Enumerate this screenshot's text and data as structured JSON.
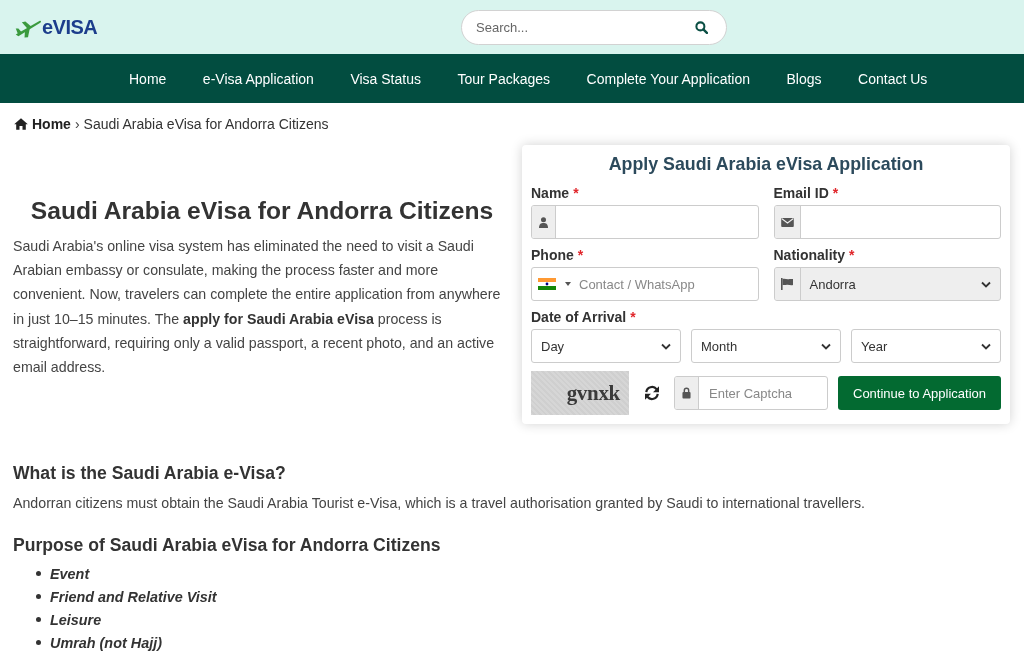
{
  "header": {
    "logo_text": "eVISA",
    "search": {
      "placeholder": "Search..."
    }
  },
  "nav": [
    "Home",
    "e-Visa Application",
    "Visa Status",
    "Tour Packages",
    "Complete Your Application",
    "Blogs",
    "Contact Us"
  ],
  "breadcrumb": {
    "separator": "›",
    "items": [
      {
        "label": "Home",
        "kind": "home"
      },
      {
        "label": "Saudi Arabia eVisa for Andorra Citizens",
        "kind": "current"
      }
    ]
  },
  "intro": {
    "title": "Saudi Arabia eVisa for Andorra Citizens",
    "paragraph": "Saudi Arabia's online visa system has eliminated the need to visit a Saudi Arabian embassy or consulate, making the process faster and more convenient. Now, travelers can complete the entire application from anywhere in just 10–15 minutes. The **apply for Saudi Arabia eVisa** process is straightforward, requiring only a valid passport, a recent photo, and an active email address."
  },
  "form": {
    "title": "Apply Saudi Arabia eVisa Application",
    "fields": [
      {
        "kind": "text",
        "label": "Name",
        "required_mark": "*",
        "disabled": false
      },
      {
        "kind": "email",
        "label": "Email ID",
        "required_mark": "*",
        "disabled": false
      },
      {
        "kind": "phone",
        "label": "Phone",
        "required_mark": "*",
        "placeholder": "Contact / WhatsApp",
        "disabled": false
      },
      {
        "kind": "select",
        "label": "Nationality",
        "required_mark": "*",
        "value": "Andorra",
        "disabled": true
      }
    ],
    "arrival": {
      "label": "Date of Arrival",
      "required_mark": "*",
      "selects": [
        "Day",
        "Month",
        "Year"
      ]
    },
    "captcha": {
      "image_text": "gvnxk",
      "placeholder": "Enter Captcha"
    },
    "submit": "Continue to Application"
  },
  "sections": [
    {
      "heading": "What is the Saudi Arabia e-Visa?",
      "paragraph": "Andorran citizens must obtain the Saudi Arabia Tourist e-Visa, which is a travel authorisation granted by Saudi to international travellers."
    },
    {
      "heading": "Purpose of Saudi Arabia eVisa for Andorra Citizens",
      "items": [
        "Event",
        "Friend and Relative Visit",
        "Leisure",
        "Umrah (not Hajj)"
      ]
    }
  ]
}
